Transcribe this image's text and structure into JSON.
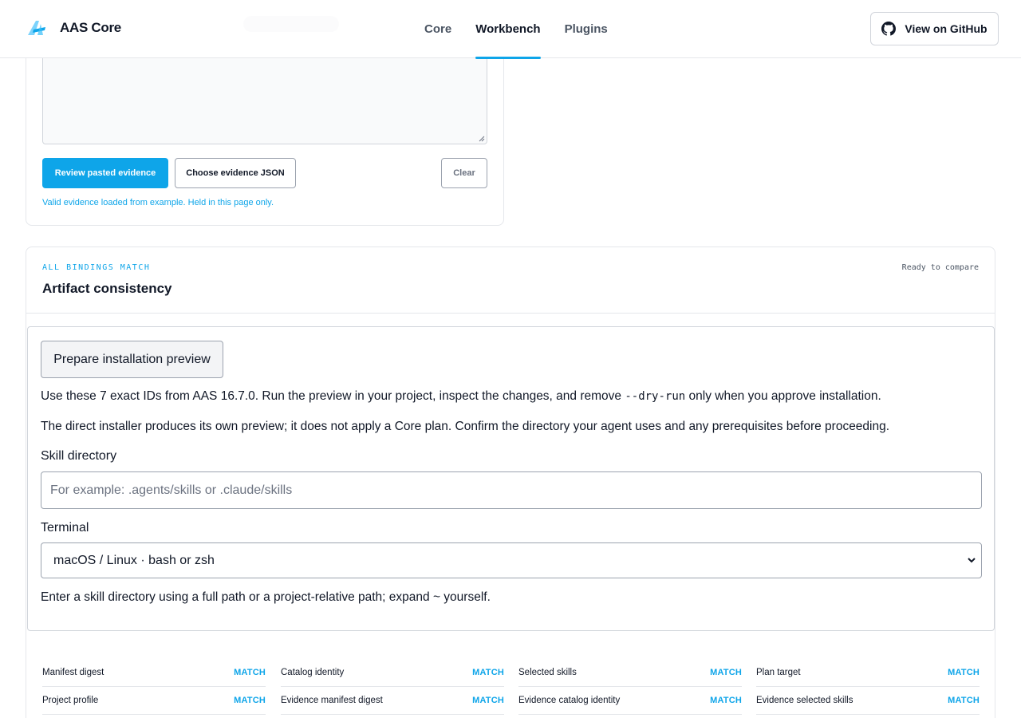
{
  "header": {
    "brand": "AAS Core",
    "nav": [
      {
        "label": "Core",
        "active": false
      },
      {
        "label": "Workbench",
        "active": true
      },
      {
        "label": "Plugins",
        "active": false
      }
    ],
    "github_button": "View on GitHub"
  },
  "evidence": {
    "review_button": "Review pasted evidence",
    "choose_button": "Choose evidence JSON",
    "clear_button": "Clear",
    "status": "Valid evidence loaded from example. Held in this page only."
  },
  "consistency": {
    "eyebrow": "ALL BINDINGS MATCH",
    "title": "Artifact consistency",
    "ready": "Ready to compare"
  },
  "install": {
    "prepare_button": "Prepare installation preview",
    "intro_before": "Use these 7 exact IDs from AAS 16.7.0. Run the preview in your project, inspect the changes, and remove ",
    "intro_code": "--dry-run",
    "intro_after": " only when you approve installation.",
    "note": "The direct installer produces its own preview; it does not apply a Core plan. Confirm the directory your agent uses and any prerequisites before proceeding.",
    "skill_dir_label": "Skill directory",
    "skill_dir_placeholder": "For example: .agents/skills or .claude/skills",
    "terminal_label": "Terminal",
    "terminal_selected": "macOS / Linux · bash or zsh",
    "hint": "Enter a skill directory using a full path or a project-relative path; expand ~ yourself."
  },
  "bindings": [
    [
      {
        "name": "Manifest digest",
        "status": "MATCH"
      },
      {
        "name": "Project profile",
        "status": "MATCH"
      }
    ],
    [
      {
        "name": "Catalog identity",
        "status": "MATCH"
      },
      {
        "name": "Evidence manifest digest",
        "status": "MATCH"
      }
    ],
    [
      {
        "name": "Selected skills",
        "status": "MATCH"
      },
      {
        "name": "Evidence catalog identity",
        "status": "MATCH"
      }
    ],
    [
      {
        "name": "Plan target",
        "status": "MATCH"
      },
      {
        "name": "Evidence selected skills",
        "status": "MATCH"
      }
    ]
  ],
  "colors": {
    "accent": "#0ea5e9",
    "border": "#e5e7eb",
    "text": "#111827"
  }
}
